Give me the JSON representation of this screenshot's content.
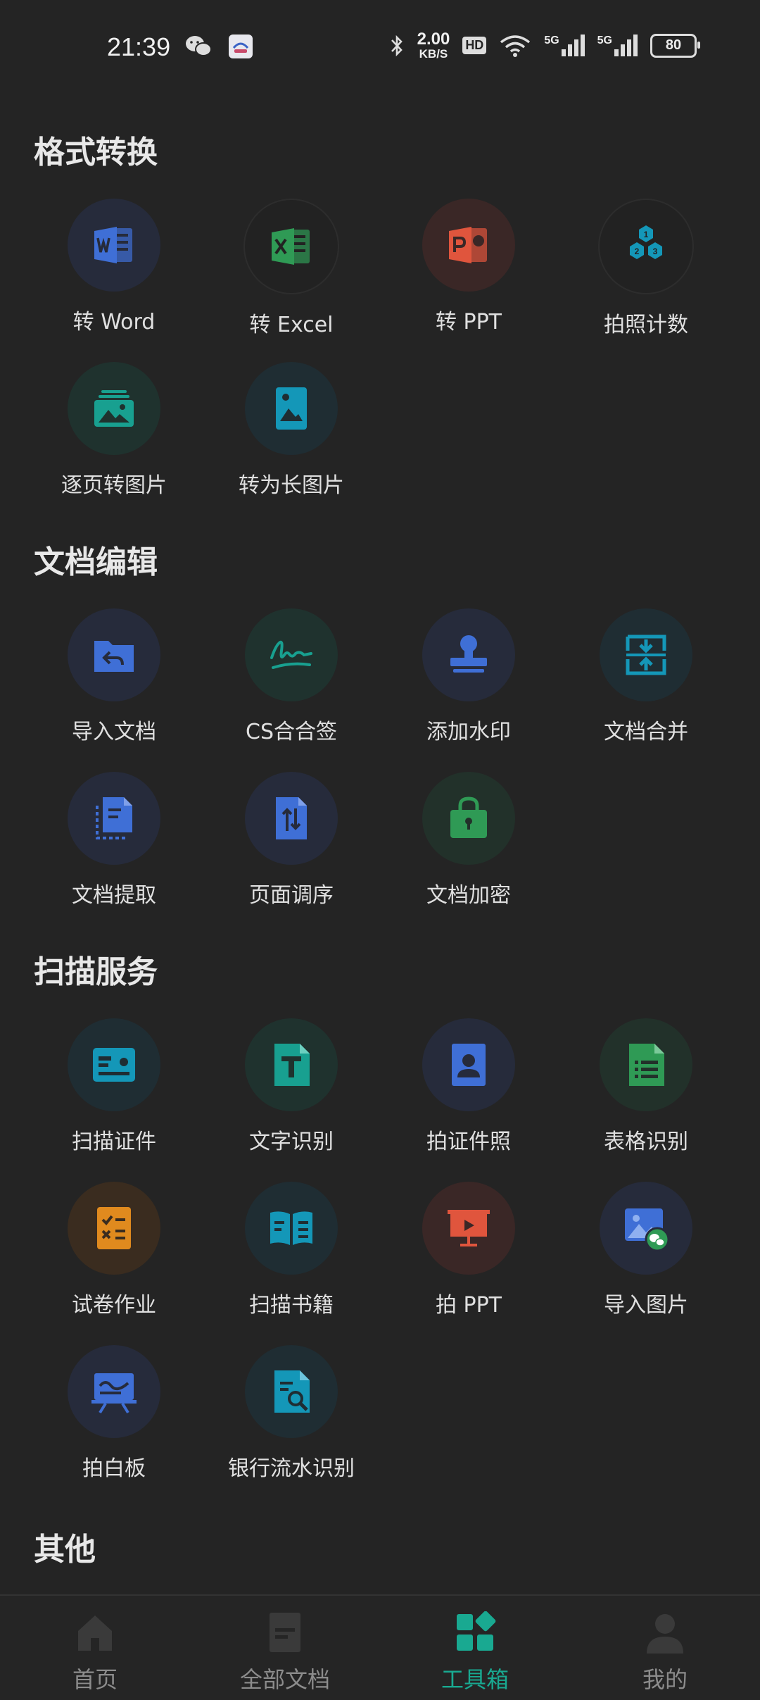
{
  "status": {
    "time": "21:39",
    "net_speed": "2.00",
    "net_unit": "KB/S",
    "hd": "HD",
    "net1": "5G",
    "net2": "5G",
    "battery": "80"
  },
  "colors": {
    "accent": "#19a991",
    "blue": "#3f6fd6",
    "green": "#2f9a55",
    "red": "#e0553d",
    "teal": "#1497b8",
    "orange": "#e08a1e",
    "cyan": "#18a090"
  },
  "sections": {
    "format": {
      "title": "格式转换",
      "items": [
        {
          "label": "转 Word",
          "icon": "word-icon"
        },
        {
          "label": "转 Excel",
          "icon": "excel-icon"
        },
        {
          "label": "转 PPT",
          "icon": "ppt-icon"
        },
        {
          "label": "拍照计数",
          "icon": "count-icon"
        },
        {
          "label": "逐页转图片",
          "icon": "image-stack-icon"
        },
        {
          "label": "转为长图片",
          "icon": "long-image-icon"
        }
      ]
    },
    "edit": {
      "title": "文档编辑",
      "items": [
        {
          "label": "导入文档",
          "icon": "import-folder-icon"
        },
        {
          "label": "CS合合签",
          "icon": "signature-icon"
        },
        {
          "label": "添加水印",
          "icon": "stamp-icon"
        },
        {
          "label": "文档合并",
          "icon": "merge-icon"
        },
        {
          "label": "文档提取",
          "icon": "extract-icon"
        },
        {
          "label": "页面调序",
          "icon": "reorder-icon"
        },
        {
          "label": "文档加密",
          "icon": "lock-icon"
        }
      ]
    },
    "scan": {
      "title": "扫描服务",
      "items": [
        {
          "label": "扫描证件",
          "icon": "id-card-icon"
        },
        {
          "label": "文字识别",
          "icon": "text-ocr-icon"
        },
        {
          "label": "拍证件照",
          "icon": "id-photo-icon"
        },
        {
          "label": "表格识别",
          "icon": "table-ocr-icon"
        },
        {
          "label": "试卷作业",
          "icon": "exam-icon"
        },
        {
          "label": "扫描书籍",
          "icon": "book-icon"
        },
        {
          "label": "拍 PPT",
          "icon": "presentation-icon"
        },
        {
          "label": "导入图片",
          "icon": "import-image-icon"
        },
        {
          "label": "拍白板",
          "icon": "whiteboard-icon"
        },
        {
          "label": "银行流水识别",
          "icon": "bank-statement-icon"
        }
      ]
    },
    "other": {
      "title": "其他"
    }
  },
  "nav": {
    "items": [
      {
        "label": "首页",
        "icon": "home-icon"
      },
      {
        "label": "全部文档",
        "icon": "documents-icon"
      },
      {
        "label": "工具箱",
        "icon": "toolbox-icon",
        "active": true
      },
      {
        "label": "我的",
        "icon": "profile-icon"
      }
    ]
  }
}
